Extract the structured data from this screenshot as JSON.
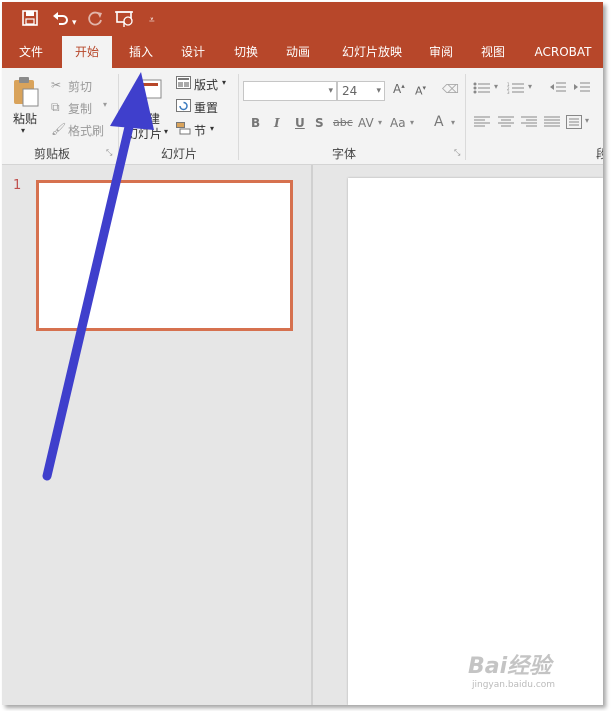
{
  "qat": {
    "save_icon": "save-icon",
    "undo_icon": "undo-icon",
    "redo_icon": "redo-icon",
    "start_show_icon": "start-from-beginning-icon",
    "customize_icon": "customize-qat-icon"
  },
  "tabs": [
    "文件",
    "开始",
    "插入",
    "设计",
    "切换",
    "动画",
    "幻灯片放映",
    "审阅",
    "视图",
    "ACROBAT"
  ],
  "active_tab": "开始",
  "clipboard": {
    "paste": "粘贴",
    "cut": "剪切",
    "copy": "复制",
    "format_painter": "格式刷",
    "group_label": "剪贴板"
  },
  "slides_group": {
    "new_slide_line1": "建",
    "new_slide_line2": "幻灯片",
    "layout": "版式",
    "reset": "重置",
    "section": "节",
    "group_label": "幻灯片"
  },
  "font_group": {
    "font_name": "",
    "font_size": "24",
    "group_label": "字体",
    "bold": "B",
    "italic": "I",
    "underline": "U",
    "shadow": "S",
    "strike": "abc",
    "spacing": "AV",
    "case": "Aa",
    "color": "A"
  },
  "paragraph_group": {
    "group_label_partial": "段"
  },
  "slide_panel": {
    "slide_number": "1"
  },
  "watermark": {
    "main": "Bai经验",
    "sub": "jingyan.baidu.com"
  },
  "colors": {
    "accent": "#b7472a",
    "thumb_border": "#d6714f",
    "annotation_arrow": "#3f3fcc"
  }
}
